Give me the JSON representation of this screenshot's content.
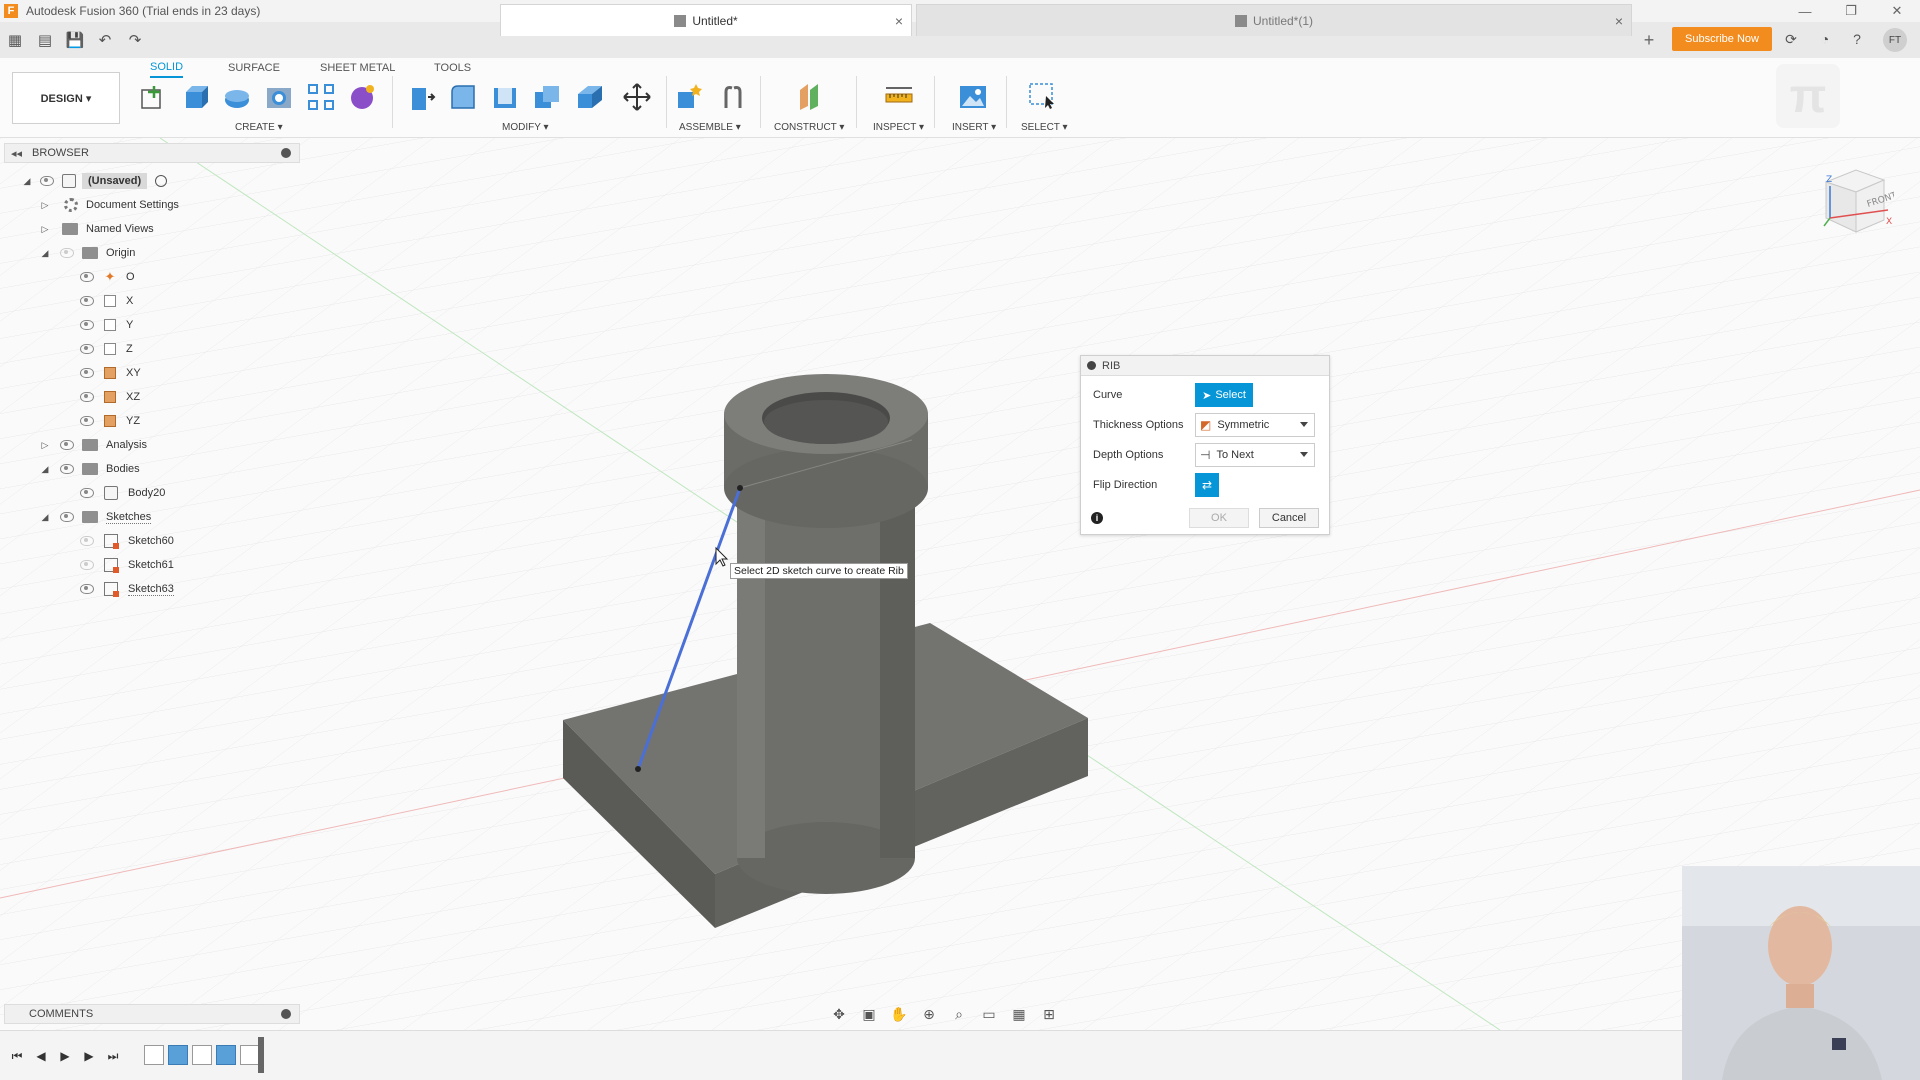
{
  "window": {
    "title": "Autodesk Fusion 360 (Trial ends in 23 days)",
    "logo_letter": "F",
    "minimize": "—",
    "restore": "❐",
    "close": "✕"
  },
  "tabs": [
    {
      "label": "Untitled*",
      "active": true
    },
    {
      "label": "Untitled*(1)",
      "active": false
    }
  ],
  "tab_close": "×",
  "new_tab": "+",
  "subscribe_label": "Subscribe Now",
  "user_initials": "FT",
  "workspace": {
    "mode_label": "DESIGN ▾",
    "tabs": [
      "SOLID",
      "SURFACE",
      "SHEET METAL",
      "TOOLS"
    ],
    "active_tab": "SOLID"
  },
  "tool_groups": [
    {
      "label": "CREATE ▾"
    },
    {
      "label": "MODIFY ▾"
    },
    {
      "label": "ASSEMBLE ▾"
    },
    {
      "label": "CONSTRUCT ▾"
    },
    {
      "label": "INSPECT ▾"
    },
    {
      "label": "INSERT ▾"
    },
    {
      "label": "SELECT ▾"
    }
  ],
  "browser": {
    "title": "BROWSER",
    "root": "(Unsaved)",
    "items": [
      {
        "label": "Document Settings"
      },
      {
        "label": "Named Views"
      },
      {
        "label": "Origin"
      },
      {
        "label": "O"
      },
      {
        "label": "X"
      },
      {
        "label": "Y"
      },
      {
        "label": "Z"
      },
      {
        "label": "XY"
      },
      {
        "label": "XZ"
      },
      {
        "label": "YZ"
      },
      {
        "label": "Analysis"
      },
      {
        "label": "Bodies"
      },
      {
        "label": "Body20"
      },
      {
        "label": "Sketches"
      },
      {
        "label": "Sketch60"
      },
      {
        "label": "Sketch61"
      },
      {
        "label": "Sketch63"
      }
    ]
  },
  "rib_dialog": {
    "title": "RIB",
    "curve_label": "Curve",
    "select_label": "Select",
    "thickness_label": "Thickness Options",
    "thickness_value": "Symmetric",
    "depth_label": "Depth Options",
    "depth_value": "To Next",
    "flip_label": "Flip Direction",
    "ok_label": "OK",
    "cancel_label": "Cancel"
  },
  "tooltip": "Select 2D sketch curve to create Rib",
  "comments_title": "COMMENTS",
  "viewcube": {
    "face": "FRONT",
    "axis_x": "X",
    "axis_z": "Z"
  },
  "colors": {
    "accent": "#0696d7",
    "subscribe": "#f28c1e",
    "body_gray": "#6b6b68",
    "sketch_line": "#4a6fd6"
  }
}
